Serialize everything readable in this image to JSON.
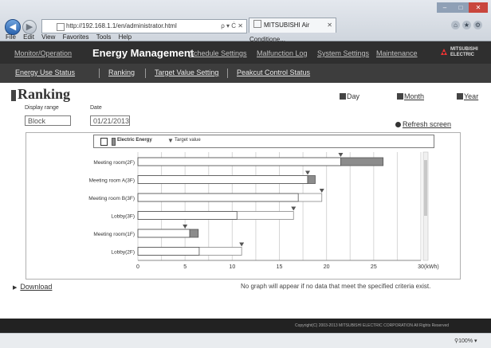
{
  "browser": {
    "url": "http://192.168.1.1/en/administrator.html",
    "search_controls": "ρ ▾ Ċ ✕",
    "tab_title": "MITSUBISHI Air Conditione...",
    "menu": [
      "File",
      "Edit",
      "View",
      "Favorites",
      "Tools",
      "Help"
    ],
    "zoom": "100%"
  },
  "nav": {
    "items": [
      "Monitor/Operation",
      "Energy Management",
      "Schedule Settings",
      "Malfunction Log",
      "System Settings",
      "Maintenance"
    ],
    "logo_text": "MITSUBISHI\nELECTRIC"
  },
  "subnav": {
    "items": [
      "Energy Use Status",
      "Ranking",
      "Target Value Setting",
      "Peakcut Control Status"
    ]
  },
  "page": {
    "title": "Ranking",
    "display_range_label": "Display range",
    "display_range_value": "Block",
    "date_label": "Date",
    "date_value": "01/21/2013",
    "periods": [
      "Day",
      "Month",
      "Year"
    ],
    "refresh_label": "Refresh screen",
    "download_label": "Download",
    "note": "No graph will appear if no data that meet the specified criteria exist."
  },
  "legend": {
    "energy_label": "Electric Energy",
    "target_label": "Target value"
  },
  "footer": {
    "copyright": "Copyright(C) 2003-2013 MITSUBISHI ELECTRIC CORPORATION All Rights Reserved"
  },
  "colors": {
    "nav_bg": "#2f2f2f",
    "subnav_bg": "#3d3d3d",
    "bar_fill": "#8c8c8c",
    "target_marker": "#555555"
  },
  "chart_data": {
    "type": "bar",
    "orientation": "horizontal",
    "categories": [
      "Meeting room(2F)",
      "Meeting room A(3F)",
      "Meeting room B(3F)",
      "Lobby(3F)",
      "Meeting room(1F)",
      "Lobby(2F)"
    ],
    "series": [
      {
        "name": "Electric Energy",
        "values": [
          21.5,
          18.0,
          17.0,
          10.5,
          5.5,
          6.5
        ]
      },
      {
        "name": "Target value",
        "values": [
          21.5,
          18.0,
          19.5,
          16.5,
          5.0,
          11.0
        ]
      }
    ],
    "overrun": [
      4.5,
      0.8,
      0,
      0,
      0.9,
      0
    ],
    "xlim": [
      0,
      30
    ],
    "xticks": [
      0,
      5,
      10,
      15,
      20,
      25,
      30
    ],
    "xlabel": "(kWh)",
    "grid": true
  }
}
